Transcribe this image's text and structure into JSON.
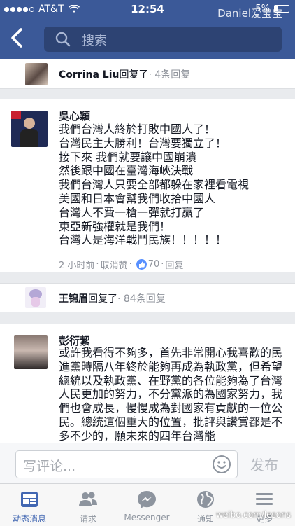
{
  "status_bar": {
    "carrier": "AT&T",
    "time": "12:54",
    "battery": "5%"
  },
  "watermark": "Daniel爱宝宝",
  "search": {
    "placeholder": "搜索"
  },
  "replies": [
    {
      "name": "Corrina Liu",
      "action": "回复了",
      "count": "· 4条回复"
    },
    {
      "name": "王锦眉",
      "action": "回复了",
      "count": "· 84条回复"
    }
  ],
  "comments": [
    {
      "name": "吳心穎",
      "text": "我們台灣人終於打敗中國人了！\n台灣民主大勝利！台灣要獨立了！\n接下來 我們就要讓中國崩潰\n然後跟中國在臺灣海峽決戰\n我們台灣人只要全部都躲在家裡看電視\n美國和日本會幫我們收拾中國人\n台灣人不費一槍一彈就打贏了\n東亞新強權就是我們！\n台灣人是海洋戰鬥民族！！！！！",
      "time": "2 小时前",
      "unlike": "取消赞",
      "likes": "70",
      "reply": "回复"
    },
    {
      "name": "彭衍絜",
      "text": "或許我看得不夠多，首先非常開心我喜歡的民進黨時隔八年終於能夠再成為執政黨，但希望總統以及執政黨、在野黨的各位能夠為了台灣人民更加的努力，不分黨派的為國家努力，我們也會成長，慢慢成為對國家有貢獻的一位公民。總統這個重大的位置，批評與讚賞都是不多不少的，願未來的四年台灣能"
    }
  ],
  "composer": {
    "placeholder": "写评论...",
    "send_label": "发布"
  },
  "tabs": [
    {
      "label": "动态消息",
      "icon": "news-feed-icon"
    },
    {
      "label": "请求",
      "icon": "friend-requests-icon"
    },
    {
      "label": "Messenger",
      "icon": "messenger-icon"
    },
    {
      "label": "通知",
      "icon": "notifications-globe-icon"
    },
    {
      "label": "更多",
      "icon": "more-menu-icon"
    }
  ],
  "weibo_watermark": "weibo.com/lesons",
  "colors": {
    "brand": "#3b5998",
    "link_blue": "#4267b2",
    "like_blue": "#5890ff"
  }
}
